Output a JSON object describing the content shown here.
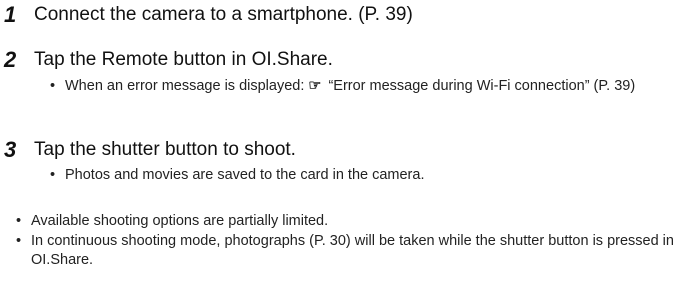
{
  "steps": [
    {
      "number": "1",
      "text": "Connect the camera to a smartphone. (P. 39)"
    },
    {
      "number": "2",
      "text": "Tap the Remote button in OI.Share.",
      "sub_prefix": "When an error message is displayed:",
      "sub_icon": "☞",
      "sub_text": "“Error message during Wi-Fi connection” (P. 39)"
    },
    {
      "number": "3",
      "text": "Tap the shutter button to shoot.",
      "sub_text": "Photos and movies are saved to the card in the camera."
    }
  ],
  "bullet_char": "•",
  "notes": [
    "Available shooting options are partially limited.",
    "In continuous shooting mode, photographs (P. 30) will be taken while the shutter button is pressed in OI.Share."
  ],
  "icons": {
    "reference": "pointing-hand-reference-icon"
  }
}
